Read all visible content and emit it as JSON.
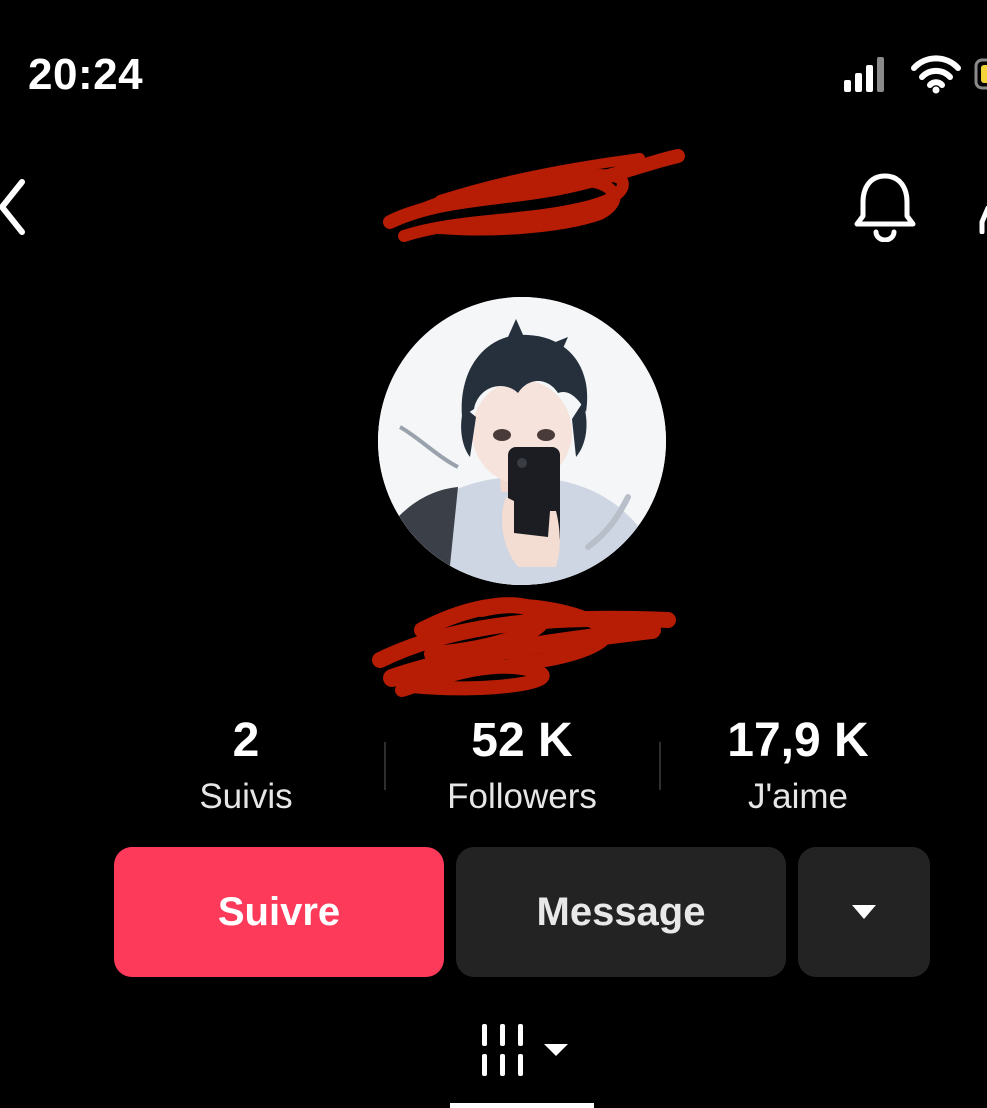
{
  "status_bar": {
    "time": "20:24",
    "icons": [
      "cellular-signal-icon",
      "wifi-icon",
      "battery-icon"
    ]
  },
  "nav": {
    "back_icon": "chevron-left-icon",
    "notification_icon": "bell-icon",
    "username_redacted": true
  },
  "profile": {
    "avatar": "anime-avatar-image",
    "display_name_redacted": true,
    "redaction_color": "#b71c05"
  },
  "stats": [
    {
      "value": "2",
      "label": "Suivis"
    },
    {
      "value": "52 K",
      "label": "Followers"
    },
    {
      "value": "17,9 K",
      "label": "J'aime"
    }
  ],
  "actions": {
    "follow_label": "Suivre",
    "message_label": "Message",
    "more_icon": "caret-down-icon",
    "follow_color": "#fe3a5b"
  },
  "tabs": {
    "active_icon": "video-grid-icon"
  }
}
